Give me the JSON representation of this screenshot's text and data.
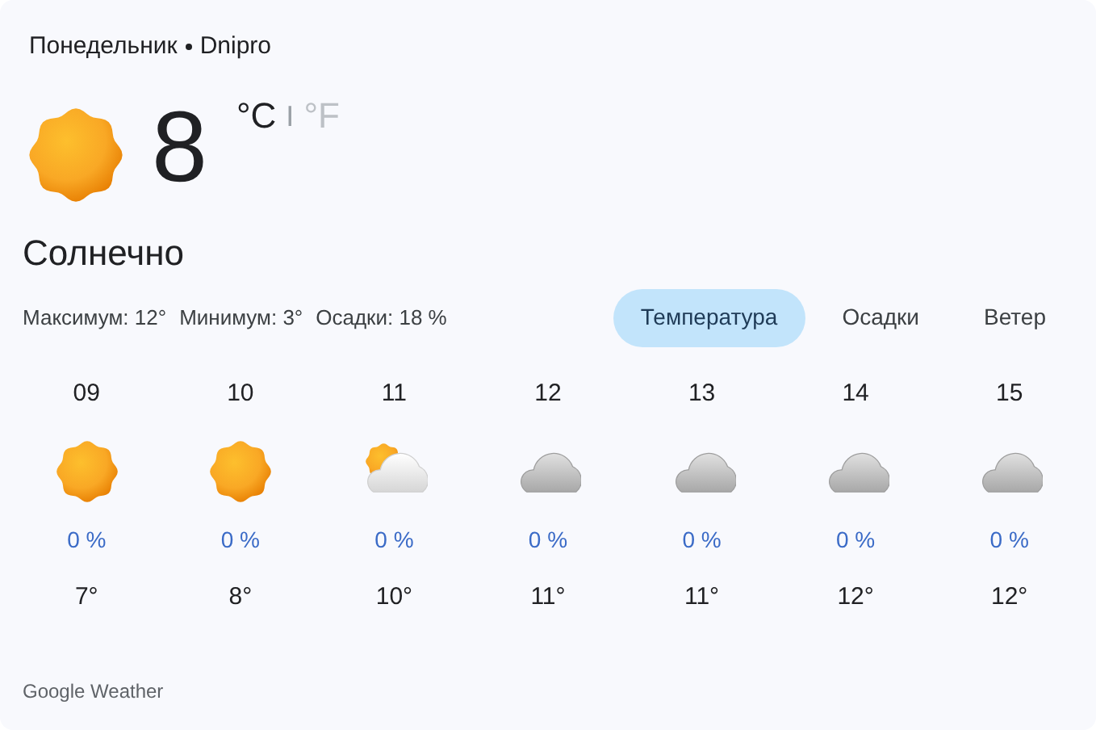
{
  "header": {
    "day": "Понедельник",
    "city": "Dnipro"
  },
  "current": {
    "kind": "sunny",
    "temperature": "8",
    "units": [
      {
        "label": "°C",
        "selected": true
      },
      {
        "label": "°F",
        "selected": false
      }
    ],
    "separator": "I",
    "condition": "Солнечно",
    "stats": [
      "Максимум: 12°",
      "Минимум: 3°",
      "Осадки: 18 %"
    ]
  },
  "tabs": [
    {
      "label": "Температура",
      "selected": true
    },
    {
      "label": "Осадки",
      "selected": false
    },
    {
      "label": "Ветер",
      "selected": false
    }
  ],
  "hours": [
    {
      "time": "09",
      "kind": "sunny",
      "precipitation": "0 %",
      "temperature": "7°"
    },
    {
      "time": "10",
      "kind": "sunny",
      "precipitation": "0 %",
      "temperature": "8°"
    },
    {
      "time": "11",
      "kind": "partly-cloudy",
      "precipitation": "0 %",
      "temperature": "10°"
    },
    {
      "time": "12",
      "kind": "cloudy",
      "precipitation": "0 %",
      "temperature": "11°"
    },
    {
      "time": "13",
      "kind": "cloudy",
      "precipitation": "0 %",
      "temperature": "11°"
    },
    {
      "time": "14",
      "kind": "cloudy",
      "precipitation": "0 %",
      "temperature": "12°"
    },
    {
      "time": "15",
      "kind": "cloudy",
      "precipitation": "0 %",
      "temperature": "12°"
    }
  ],
  "footer": "Google Weather"
}
